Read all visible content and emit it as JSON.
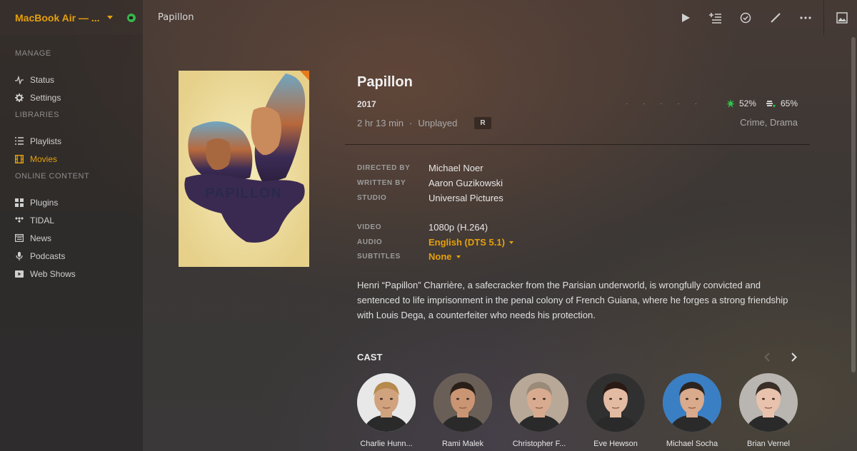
{
  "colors": {
    "accent": "#e5a00d",
    "secure": "#38b34a",
    "rt_green": "#2ec84a"
  },
  "header": {
    "server_name": "MacBook Air — ...",
    "page_title": "Papillon",
    "toolbar": [
      "play-icon",
      "add-to-queue-icon",
      "mark-watched-icon",
      "edit-icon",
      "more-icon",
      "artwork-icon"
    ]
  },
  "sidebar": {
    "sections": [
      {
        "title": "MANAGE",
        "items": [
          {
            "label": "Status",
            "icon": "pulse-icon"
          },
          {
            "label": "Settings",
            "icon": "gear-icon"
          }
        ]
      },
      {
        "title": "LIBRARIES",
        "items": [
          {
            "label": "Playlists",
            "icon": "playlist-icon"
          },
          {
            "label": "Movies",
            "icon": "film-icon",
            "active": true
          }
        ]
      },
      {
        "title": "ONLINE CONTENT",
        "items": [
          {
            "label": "Plugins",
            "icon": "grid-icon"
          },
          {
            "label": "TIDAL",
            "icon": "tidal-icon"
          },
          {
            "label": "News",
            "icon": "news-icon"
          },
          {
            "label": "Podcasts",
            "icon": "microphone-icon"
          },
          {
            "label": "Web Shows",
            "icon": "web-show-icon"
          }
        ]
      }
    ]
  },
  "poster": {
    "text": "PAPILLON"
  },
  "movie": {
    "title": "Papillon",
    "year": "2017",
    "duration": "2 hr 13 min",
    "separator": "·",
    "play_state": "Unplayed",
    "content_rating": "R",
    "genres": "Crime, Drama",
    "user_stars": "· · · · ·",
    "user_star_rating": 0,
    "critic_score": "52%",
    "audience_score": "65%"
  },
  "credits": {
    "directed_by": {
      "label": "DIRECTED BY",
      "value": "Michael Noer"
    },
    "written_by": {
      "label": "WRITTEN BY",
      "value": "Aaron Guzikowski"
    },
    "studio": {
      "label": "STUDIO",
      "value": "Universal Pictures"
    }
  },
  "media": {
    "video": {
      "label": "VIDEO",
      "value": "1080p (H.264)"
    },
    "audio": {
      "label": "AUDIO",
      "value": "English (DTS 5.1)"
    },
    "subtitles": {
      "label": "SUBTITLES",
      "value": "None"
    }
  },
  "summary": "Henri “Papillon” Charrière, a safecracker from the Parisian underworld, is wrongfully convicted and sentenced to life imprisonment in the penal colony of French Guiana, where he forges a strong friendship with Louis Dega, a counterfeiter who needs his protection.",
  "cast": {
    "title": "CAST",
    "members": [
      {
        "name": "Charlie Hunn...",
        "skin": "#d1a27e",
        "hair": "#b58a4c",
        "bg": "#e8e8e8"
      },
      {
        "name": "Rami Malek",
        "skin": "#c99573",
        "hair": "#2a1f18",
        "bg": "#6a5f57"
      },
      {
        "name": "Christopher F...",
        "skin": "#d8ab90",
        "hair": "#9a8a78",
        "bg": "#b8a897"
      },
      {
        "name": "Eve Hewson",
        "skin": "#e3bba2",
        "hair": "#2a1a14",
        "bg": "#303030"
      },
      {
        "name": "Michael Socha",
        "skin": "#d9aa8c",
        "hair": "#2c2420",
        "bg": "#3a7fc4"
      },
      {
        "name": "Brian Vernel",
        "skin": "#e8c2ad",
        "hair": "#3a2e28",
        "bg": "#b9b5b0"
      }
    ]
  }
}
